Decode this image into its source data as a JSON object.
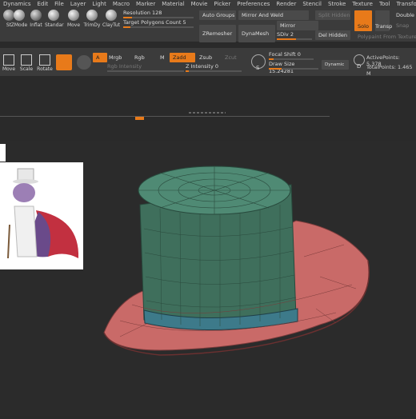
{
  "menu": [
    "Dynamics",
    "Edit",
    "File",
    "Layer",
    "Light",
    "Macro",
    "Marker",
    "Material",
    "Movie",
    "Picker",
    "Preferences",
    "Render",
    "Stencil",
    "Stroke",
    "Texture",
    "Tool",
    "Transform"
  ],
  "tools1": [
    {
      "label": "St"
    },
    {
      "label": "ZMode"
    },
    {
      "label": "Inflat"
    },
    {
      "label": "Standar"
    },
    {
      "label": "Move"
    },
    {
      "label": "TrimDy"
    },
    {
      "label": "ClayTut"
    }
  ],
  "resolution": {
    "label": "Resolution 128",
    "value": 0.12
  },
  "target_polys": {
    "label": "Target Polygons Count 5",
    "value": 0.1
  },
  "auto_groups": "Auto Groups",
  "mirror_weld": "Mirror And Weld",
  "split_hidden": "Split Hidden",
  "zremesher": "ZRemesher",
  "dynamesh": "DynaMesh",
  "mirror": "Mirror",
  "sdiv": "SDiv 2",
  "del_hidden": "Del Hidden",
  "solo": "Solo",
  "transp": "Transp",
  "double": "Double",
  "snap": "Snap",
  "polypaint": "Polypaint From Texture",
  "tools2": [
    {
      "label": "Move"
    },
    {
      "label": "Scale"
    },
    {
      "label": "Rotate"
    }
  ],
  "mode_a": "A",
  "mrgb": "Mrgb",
  "rgb": "Rgb",
  "m": "M",
  "zadd": "Zadd",
  "zsub": "Zsub",
  "zcut": "Zcut",
  "rgb_intensity": "Rgb Intensity",
  "z_intensity": "Z Intensity 0",
  "focal_shift": "Focal Shift 0",
  "draw_size": "Draw Size 15.24281",
  "dynamic": "Dynamic",
  "active_points": "ActivePoints: 5,378",
  "total_points": "TotalPoints: 1.465 M",
  "s_label": "S",
  "d_label": "D"
}
